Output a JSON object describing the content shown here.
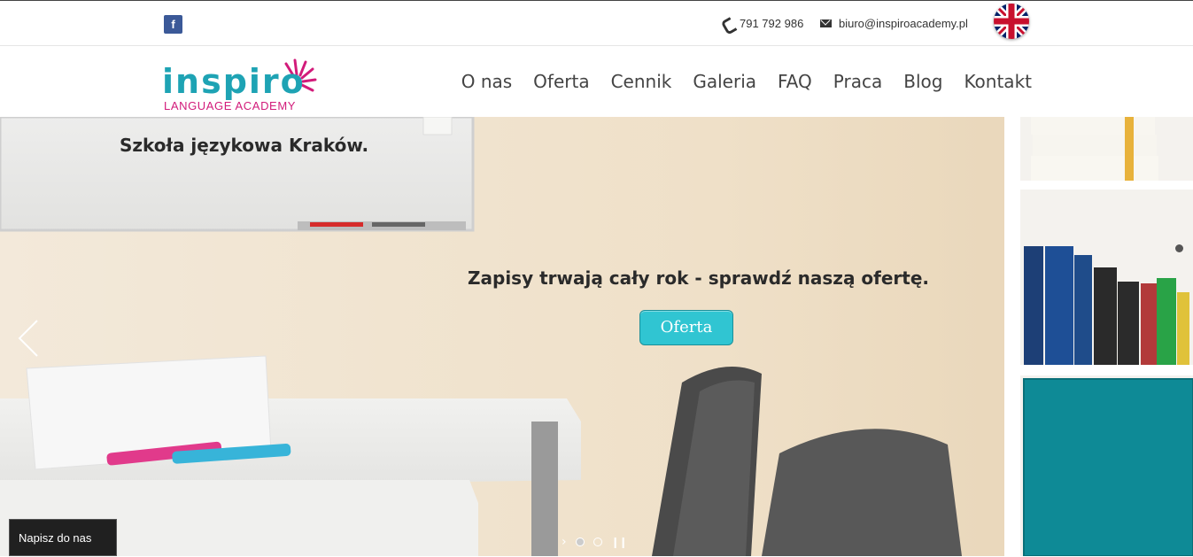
{
  "topbar": {
    "facebook_label": "f",
    "phone": "791 792 986",
    "email": "biuro@inspiroacademy.pl",
    "language_flag": "uk-flag-icon"
  },
  "header": {
    "logo_word": "inspiro",
    "logo_sub": "LANGUAGE ACADEMY",
    "nav": [
      "O nas",
      "Oferta",
      "Cennik",
      "Galeria",
      "FAQ",
      "Praca",
      "Blog",
      "Kontakt"
    ]
  },
  "hero": {
    "title": "Szkoła językowa Kraków.",
    "tagline": "Zapisy trwają cały rok - sprawdź naszą ofertę.",
    "button_label": "Oferta",
    "slide_count": 2,
    "active_slide": 1
  },
  "chat": {
    "label": "Napisz do nas"
  },
  "colors": {
    "brand_teal": "#1ea3b4",
    "brand_pink": "#d21b7a",
    "button": "#30c5d2",
    "facebook": "#3b5998"
  }
}
